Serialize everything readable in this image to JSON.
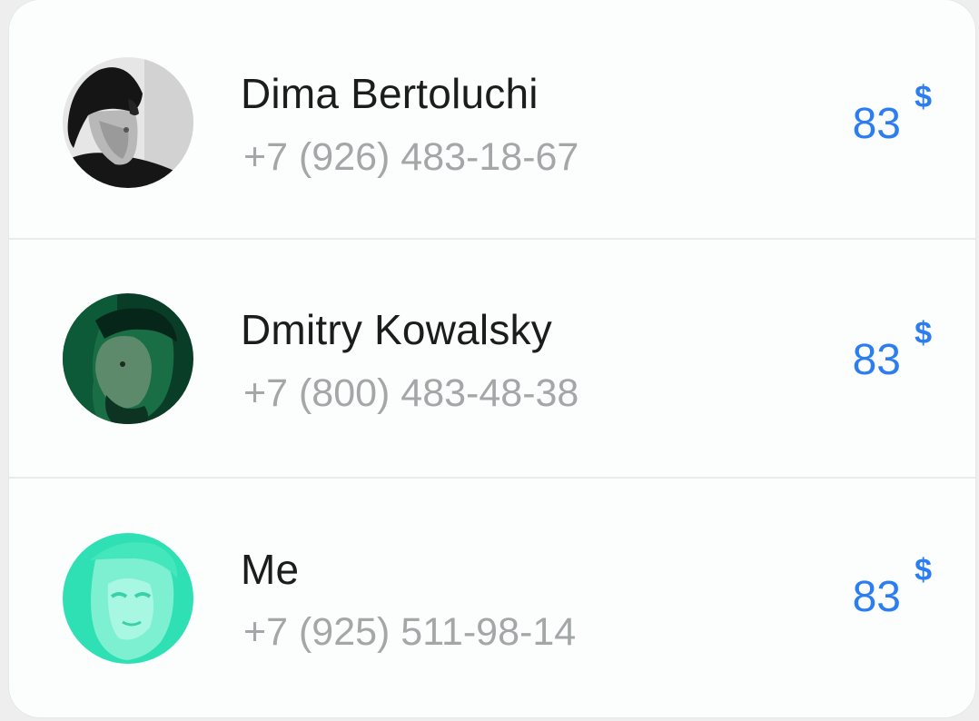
{
  "contacts": [
    {
      "name": "Dima Bertoluchi",
      "phone": "+7 (926) 483-18-67",
      "amount": "83",
      "currency": "$",
      "avatar": "person-photo-grayscale"
    },
    {
      "name": "Dmitry Kowalsky",
      "phone": "+7 (800) 483-48-38",
      "amount": "83",
      "currency": "$",
      "avatar": "person-photo-green"
    },
    {
      "name": "Me",
      "phone": "+7 (925) 511-98-14",
      "amount": "83",
      "currency": "$",
      "avatar": "person-photo-mint"
    }
  ],
  "colors": {
    "accent": "#2c7df0",
    "name_text": "#1c1c1c",
    "phone_text": "#a4a7a8",
    "card_bg": "#fcfdfd"
  }
}
